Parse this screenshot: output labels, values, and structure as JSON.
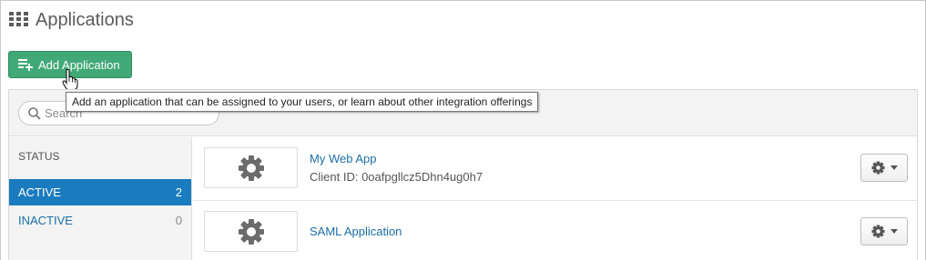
{
  "header": {
    "title": "Applications",
    "icon": "grid-icon"
  },
  "toolbar": {
    "add_label": "Add Application",
    "add_icon": "add-list-icon",
    "add_color": "#41a878",
    "tooltip": "Add an application that can be assigned to your users, or learn about other integration offerings"
  },
  "search": {
    "placeholder": "Search",
    "value": ""
  },
  "sidebar": {
    "heading": "STATUS",
    "filters": [
      {
        "label": "ACTIVE",
        "count": "2",
        "selected": true
      },
      {
        "label": "INACTIVE",
        "count": "0",
        "selected": false
      }
    ],
    "active_color": "#1a7bbf"
  },
  "apps": [
    {
      "name": "My Web App",
      "client_id": "Client ID: 0oafpgllcz5Dhn4ug0h7",
      "logo_icon": "gear-icon"
    },
    {
      "name": "SAML Application",
      "client_id": "",
      "logo_icon": "gear-icon"
    }
  ]
}
